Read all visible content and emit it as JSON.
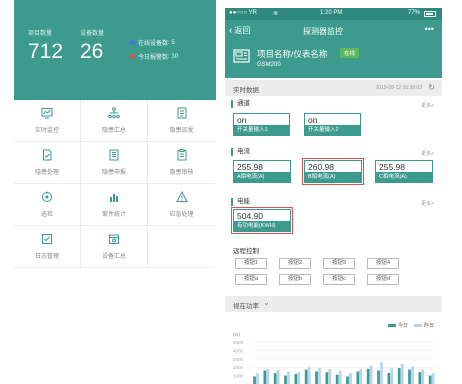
{
  "left": {
    "stats": [
      {
        "label": "项目数量",
        "value": "712"
      },
      {
        "label": "设备数量",
        "value": "26"
      }
    ],
    "online": {
      "label": "在线设备数",
      "value": "5",
      "color": "#3b7dd8"
    },
    "alarms": {
      "label": "今日报警数",
      "value": "30",
      "color": "#e0504a"
    },
    "menu": [
      {
        "label": "实时监控",
        "icon": "monitor-chart-icon"
      },
      {
        "label": "隐患汇总",
        "icon": "org-tree-icon"
      },
      {
        "label": "隐患派发",
        "icon": "dispatch-doc-icon"
      },
      {
        "label": "隐患处理",
        "icon": "doc-handle-icon"
      },
      {
        "label": "隐患申报",
        "icon": "doc-report-icon"
      },
      {
        "label": "隐患审核",
        "icon": "doc-review-icon"
      },
      {
        "label": "巡检",
        "icon": "inspection-icon"
      },
      {
        "label": "案件统计",
        "icon": "bar-stats-icon"
      },
      {
        "label": "应急处理",
        "icon": "emergency-icon"
      },
      {
        "label": "日志管理",
        "icon": "log-icon"
      },
      {
        "label": "设备汇总",
        "icon": "device-summary-icon"
      }
    ]
  },
  "right": {
    "status_bar": {
      "carrier": "●●○○○ YR",
      "wifi": "wifi-icon",
      "time": "1:20 PM",
      "battery": "77%"
    },
    "nav": {
      "back": "返回",
      "title": "探测器监控",
      "more": "•••"
    },
    "device": {
      "name": "项目名称/仪表名称",
      "badge": "在线",
      "model": "GSM200"
    },
    "realtime": {
      "label": "实时数据",
      "timestamp": "2019-08-12 08:30:03"
    },
    "more_label": "更多>",
    "switch_group": {
      "title": "通道",
      "cards": [
        {
          "value": "on",
          "caption": "开关量输入1"
        },
        {
          "value": "on",
          "caption": "开关量输入2"
        }
      ]
    },
    "current_group": {
      "title": "电流",
      "cards": [
        {
          "value": "255.98",
          "caption": "A相电流(A)"
        },
        {
          "value": "260.98",
          "caption": "B相电流(A)"
        },
        {
          "value": "255.98",
          "caption": "C相电流(A)"
        }
      ]
    },
    "energy_group": {
      "title": "电能",
      "cards": [
        {
          "value": "504.90",
          "caption": "有功电能(KWH)"
        }
      ]
    },
    "remote": {
      "title": "远程控制",
      "buttons": [
        "按钮1",
        "按钮2",
        "按钮3",
        "按钮4",
        "按钮a",
        "按钮b",
        "按钮c",
        "按钮d"
      ]
    },
    "power": {
      "label": "视在功率",
      "chevron": "chevron-down-icon"
    },
    "chart_data": {
      "type": "bar",
      "ylabel": "(w)",
      "yticks": [
        "5000",
        "4000",
        "3000",
        "2000",
        "1000"
      ],
      "ylim": [
        0,
        5000
      ],
      "legend_placement": "top-right",
      "series": [
        {
          "name": "今日",
          "color": "#3c9a8e",
          "values": [
            900,
            1600,
            1300,
            1000,
            1200,
            1700,
            1500,
            1400,
            1100,
            900,
            1500,
            1800,
            1600,
            1300,
            1900,
            1700,
            1400,
            1000
          ]
        },
        {
          "name": "昨日",
          "color": "#b7d4ee",
          "values": [
            1300,
            1800,
            1700,
            1500,
            1400,
            2000,
            1900,
            1800,
            1600,
            1300,
            1800,
            2200,
            2600,
            1900,
            2400,
            2100,
            1700,
            1300
          ]
        }
      ]
    }
  }
}
